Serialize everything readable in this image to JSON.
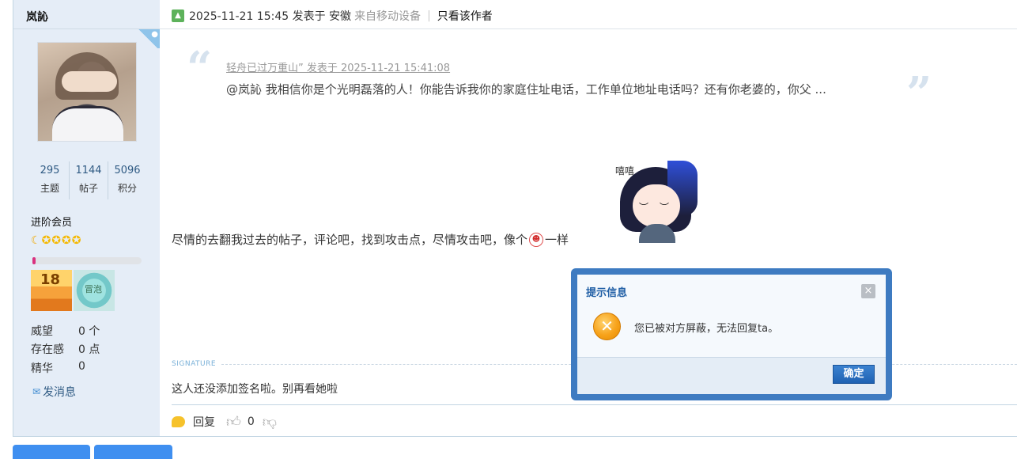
{
  "author": {
    "name": "岚訫",
    "corner_badge_icon": "apple-icon",
    "stats": [
      {
        "value": "295",
        "label": "主题"
      },
      {
        "value": "1144",
        "label": "帖子"
      },
      {
        "value": "5096",
        "label": "积分"
      }
    ],
    "rank": "进阶会员",
    "level_progress_percent": 3,
    "medals": [
      "18",
      "冒泡"
    ],
    "info": [
      {
        "label": "威望",
        "value": "0 个"
      },
      {
        "label": "存在感",
        "value": "0 点"
      },
      {
        "label": "精华",
        "value": "0"
      }
    ],
    "message_link": "发消息"
  },
  "post": {
    "timestamp": "2025-11-21 15:45 发表于 安徽",
    "device": "来自移动设备",
    "separator": "|",
    "only_author": "只看该作者",
    "quote": {
      "meta": "轻舟已过万重山” 发表于 2025-11-21 15:41:08",
      "text": "@岚訫  我相信你是个光明磊落的人！你能告诉我你的家庭住址电话，工作单位地址电话吗？还有你老婆的，你父 ..."
    },
    "sticker_sfx": "嘻嘻",
    "body_before": "尽情的去翻我过去的帖子，评论吧，找到攻击点，尽情攻击吧，像个",
    "body_after": "一样",
    "signature_label": "SIGNATURE",
    "signature_text": "这人还没添加签名啦。别再看她啦",
    "reply_label": "回复",
    "like_count": "0"
  },
  "dialog": {
    "title": "提示信息",
    "message": "您已被对方屏蔽，无法回复ta。",
    "ok_label": "确定",
    "close_symbol": "×"
  },
  "bottom_buttons": [
    "",
    ""
  ],
  "colors": {
    "sidebar_bg": "#e5edf7",
    "link": "#2f5a83",
    "dialog_border": "#3e7bc1",
    "dialog_title": "#1f5ea5"
  }
}
